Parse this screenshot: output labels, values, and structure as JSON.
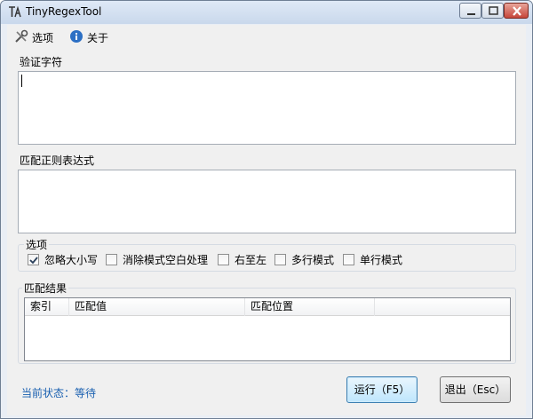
{
  "window": {
    "title": "TinyRegexTool"
  },
  "menu": {
    "options": "选项",
    "about": "关于"
  },
  "verify": {
    "label": "验证字符",
    "value": ""
  },
  "regex": {
    "label": "匹配正则表达式",
    "value": ""
  },
  "options_group": {
    "title": "选项",
    "items": [
      {
        "label": "忽略大小写",
        "checked": true
      },
      {
        "label": "消除模式空白处理",
        "checked": false
      },
      {
        "label": "右至左",
        "checked": false
      },
      {
        "label": "多行模式",
        "checked": false
      },
      {
        "label": "单行模式",
        "checked": false
      }
    ]
  },
  "results_group": {
    "title": "匹配结果",
    "columns": [
      "索引",
      "匹配值",
      "匹配位置",
      ""
    ]
  },
  "status": {
    "prefix": "当前状态：",
    "value": "等待"
  },
  "buttons": {
    "run": "运行（F5）",
    "quit": "退出（Esc）"
  },
  "colors": {
    "status_text": "#1a60b0",
    "title_gradient_top": "#dfe9f6",
    "close_button": "#c6463a"
  }
}
